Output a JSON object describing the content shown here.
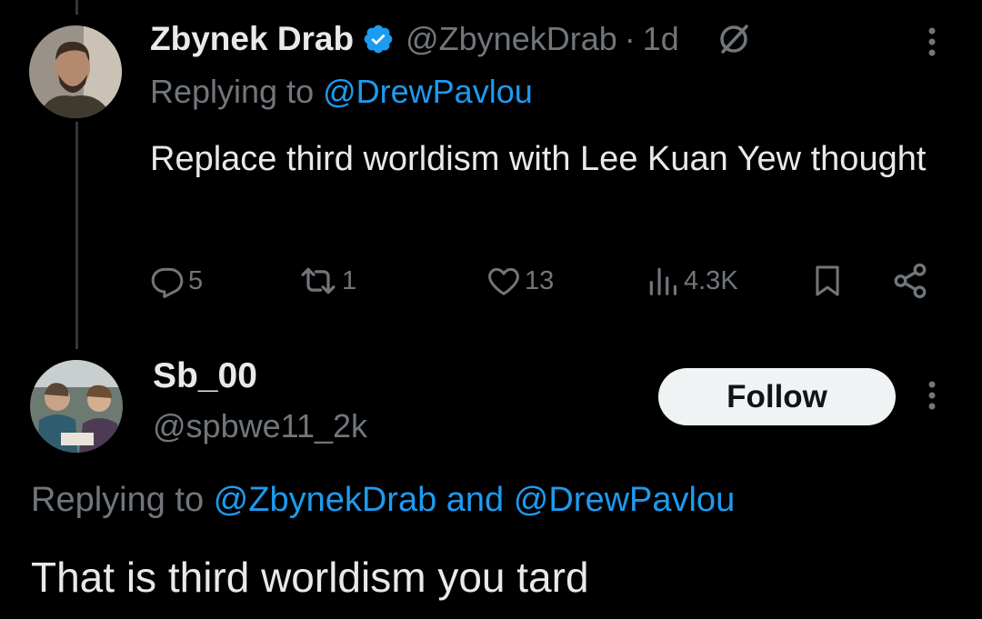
{
  "tweet": {
    "author_name": "Zbynek Drab",
    "author_handle": "@ZbynekDrab",
    "separator": "·",
    "time": "1d",
    "replying_prefix": "Replying to ",
    "replying_to": "@DrewPavlou",
    "text": "Replace third worldism with Lee Kuan Yew thought",
    "stats": {
      "replies": "5",
      "reposts": "1",
      "likes": "13",
      "views": "4.3K"
    }
  },
  "reply": {
    "author_name": "Sb_00",
    "author_handle": "@spbwe11_2k",
    "follow_label": "Follow",
    "replying_prefix": "Replying to ",
    "replying_to_1": "@ZbynekDrab",
    "replying_and": " and ",
    "replying_to_2": "@DrewPavlou",
    "text": "That is third worldism you tard"
  },
  "colors": {
    "background": "#000000",
    "primary_text": "#e7e9ea",
    "secondary_text": "#71767b",
    "link": "#1d9bf0",
    "verified": "#1d9bf0",
    "follow_button": "#eff3f4"
  }
}
